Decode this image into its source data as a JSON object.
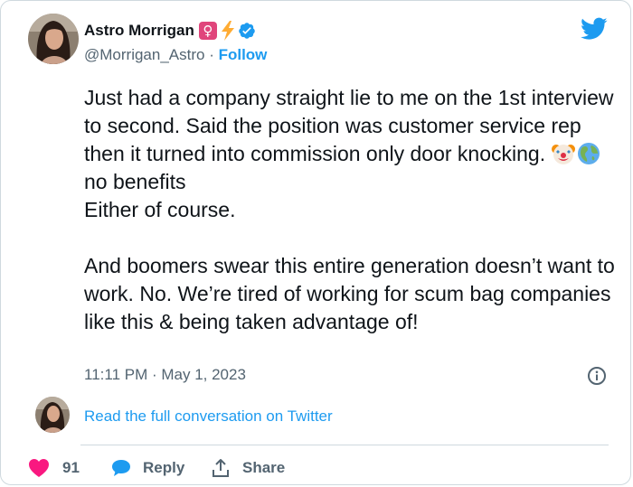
{
  "author": {
    "display_name": "Astro Morrigan",
    "handle": "@Morrigan_Astro",
    "separator": " · ",
    "follow_label": "Follow",
    "name_emojis": [
      "female-sign-emoji",
      "lightning-bolt-emoji"
    ],
    "verified": true
  },
  "tweet": {
    "line1": "Just had a company straight lie to me on the 1st interview to second. Said the position was customer service rep then it turned into commission only door knocking. ",
    "line1_emojis": [
      "clown-face-emoji",
      "earth-globe-emoji"
    ],
    "line1_tail": "no benefits",
    "line2": "Either of course.",
    "paragraph2": "And boomers swear this entire generation doesn’t want to work. No. We’re tired of working for scum bag companies like this & being taken advantage of!"
  },
  "meta": {
    "timestamp": "11:11 PM · May 1, 2023"
  },
  "conversation": {
    "link_text": "Read the full conversation on Twitter"
  },
  "actions": {
    "like_count": "91",
    "reply_label": "Reply",
    "share_label": "Share"
  },
  "colors": {
    "accent": "#1d9bf0",
    "text_primary": "#0f1419",
    "text_secondary": "#536471",
    "like": "#f91880",
    "border": "#cfd9de"
  },
  "icons": {
    "brand": "twitter-bird-icon",
    "info": "info-icon",
    "like": "heart-icon",
    "reply": "speech-bubble-icon",
    "share": "share-upload-icon"
  }
}
